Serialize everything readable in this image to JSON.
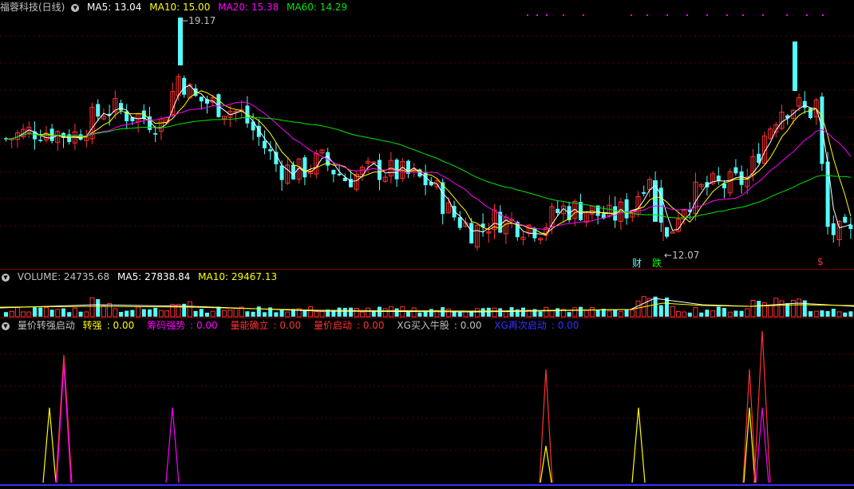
{
  "main": {
    "title": "福蓉科技(日线)",
    "ma5": "MA5: 13.04",
    "ma10": "MA10: 15.00",
    "ma20": "MA20: 15.38",
    "ma60": "MA60: 14.29",
    "high_label": "19.17",
    "low_label": "12.07",
    "tag_cai": "财",
    "tag_die": "跌",
    "tag_s": "$",
    "colors": {
      "up": "#ff3232",
      "down": "#54fcfc",
      "ma5": "#ffffff",
      "ma10": "#ffff00",
      "ma20": "#ff00ff",
      "ma60": "#00e600"
    }
  },
  "volume": {
    "label": "VOLUME: 24735.68",
    "ma5": "MA5: 27838.84",
    "ma10": "MA10: 29467.13"
  },
  "indicator": {
    "title": "量价转强启动",
    "items": [
      {
        "name": "转强",
        "value": "0.00",
        "color": "#ffff00"
      },
      {
        "name": "筹码强势",
        "value": "0.00",
        "color": "#ff00ff"
      },
      {
        "name": "量能确立",
        "value": "0.00",
        "color": "#ff3232"
      },
      {
        "name": "量价启动",
        "value": "0.00",
        "color": "#ff3232"
      },
      {
        "name": "XG买入牛股",
        "value": "0.00",
        "color": "#c0c0c0"
      },
      {
        "name": "XG再次启动",
        "value": "0.00",
        "color": "#3232ff"
      }
    ]
  }
}
